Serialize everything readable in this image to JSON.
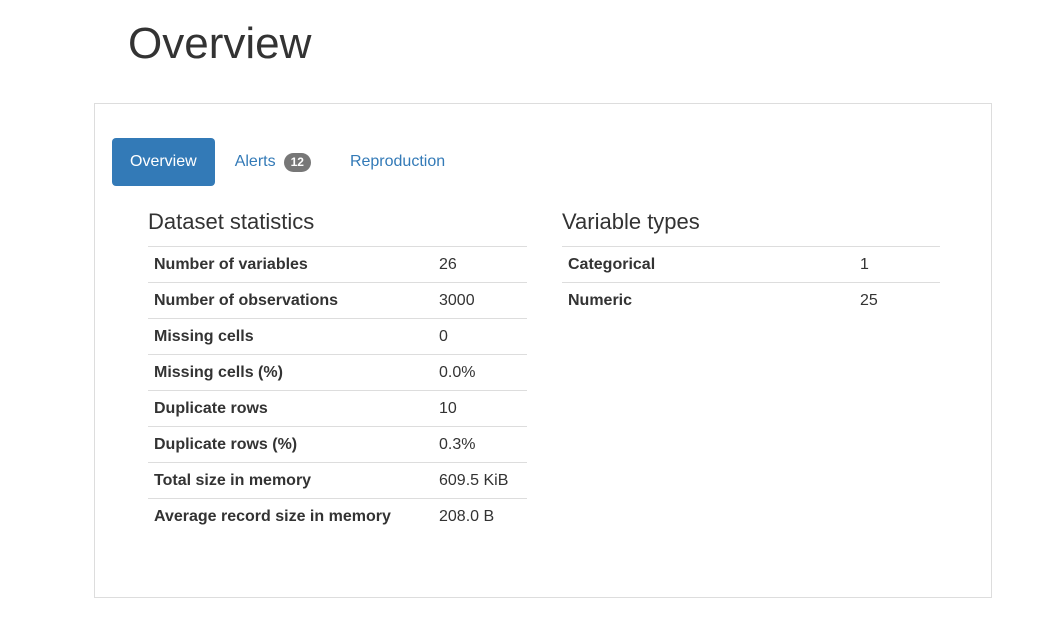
{
  "page": {
    "title": "Overview"
  },
  "tabs": [
    {
      "label": "Overview",
      "active": true
    },
    {
      "label": "Alerts",
      "badge": "12"
    },
    {
      "label": "Reproduction"
    }
  ],
  "dataset_statistics": {
    "heading": "Dataset statistics",
    "rows": [
      {
        "label": "Number of variables",
        "value": "26"
      },
      {
        "label": "Number of observations",
        "value": "3000"
      },
      {
        "label": "Missing cells",
        "value": "0"
      },
      {
        "label": "Missing cells (%)",
        "value": "0.0%"
      },
      {
        "label": "Duplicate rows",
        "value": "10"
      },
      {
        "label": "Duplicate rows (%)",
        "value": "0.3%"
      },
      {
        "label": "Total size in memory",
        "value": "609.5 KiB"
      },
      {
        "label": "Average record size in memory",
        "value": "208.0 B"
      }
    ]
  },
  "variable_types": {
    "heading": "Variable types",
    "rows": [
      {
        "label": "Categorical",
        "value": "1"
      },
      {
        "label": "Numeric",
        "value": "25"
      }
    ]
  },
  "colors": {
    "accent": "#337ab7",
    "badge": "#777777",
    "border": "#dddddd",
    "text": "#333333"
  }
}
